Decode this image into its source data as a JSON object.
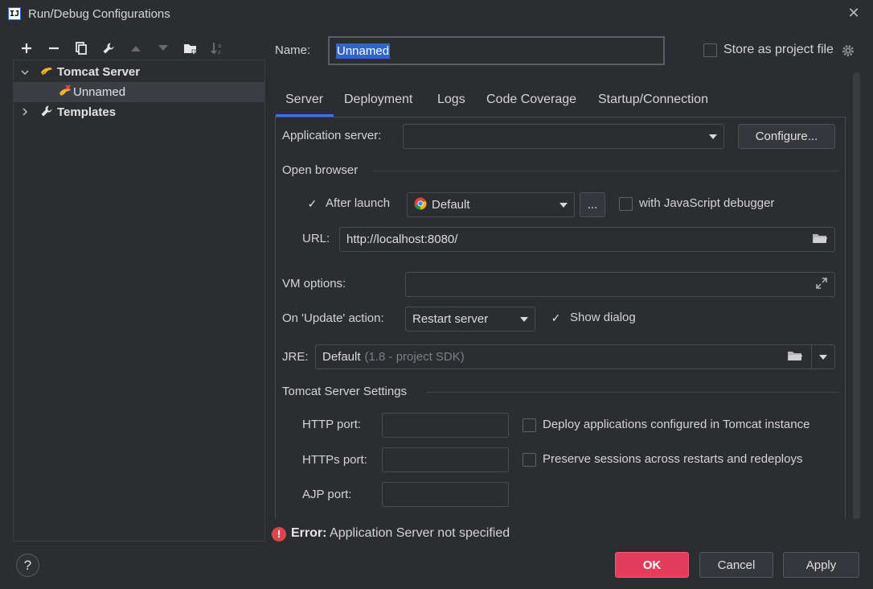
{
  "window": {
    "title": "Run/Debug Configurations",
    "app_icon_text": "IJ"
  },
  "toolbar": {
    "icons": [
      "add-icon",
      "remove-icon",
      "copy-icon",
      "wrench-icon",
      "move-up-icon",
      "move-down-icon",
      "new-folder-icon",
      "sort-icon"
    ]
  },
  "tree": {
    "items": [
      {
        "label": "Tomcat Server",
        "icon": "tomcat-icon",
        "expanded": true
      },
      {
        "label": "Unnamed",
        "icon": "tomcat-error-icon",
        "selected": true
      },
      {
        "label": "Templates",
        "icon": "wrench-icon",
        "expanded": false
      }
    ]
  },
  "name_field": {
    "label": "Name:",
    "value": "Unnamed"
  },
  "store_project": {
    "label": "Store as project file",
    "checked": false
  },
  "tabs": [
    "Server",
    "Deployment",
    "Logs",
    "Code Coverage",
    "Startup/Connection"
  ],
  "active_tab": "Server",
  "server": {
    "app_server_label": "Application server:",
    "app_server_value": "",
    "configure_button": "Configure...",
    "open_browser_title": "Open browser",
    "after_launch_label": "After launch",
    "after_launch_checked": true,
    "browser_value": "Default",
    "ellipsis_button": "...",
    "js_debugger_label": "with JavaScript debugger",
    "js_debugger_checked": false,
    "url_label": "URL:",
    "url_value": "http://localhost:8080/",
    "vm_label": "VM options:",
    "vm_value": "",
    "update_label": "On 'Update' action:",
    "update_value": "Restart server",
    "show_dialog_label": "Show dialog",
    "show_dialog_checked": true,
    "jre_label": "JRE:",
    "jre_value": "Default",
    "jre_hint": "(1.8 - project SDK)",
    "tomcat_settings_title": "Tomcat Server Settings",
    "http_port_label": "HTTP port:",
    "https_port_label": "HTTPs port:",
    "ajp_port_label": "AJP port:",
    "deploy_label": "Deploy applications configured in Tomcat instance",
    "deploy_checked": false,
    "preserve_label": "Preserve sessions across restarts and redeploys",
    "preserve_checked": false
  },
  "error": {
    "prefix": "Error:",
    "message": "Application Server not specified"
  },
  "buttons": {
    "help": "?",
    "ok": "OK",
    "cancel": "Cancel",
    "apply": "Apply"
  },
  "colors": {
    "background": "#2b2d30",
    "accent": "#3574f0",
    "ok_button": "#e23e5b",
    "error": "#d9464c",
    "selection": "#2f65ca"
  }
}
